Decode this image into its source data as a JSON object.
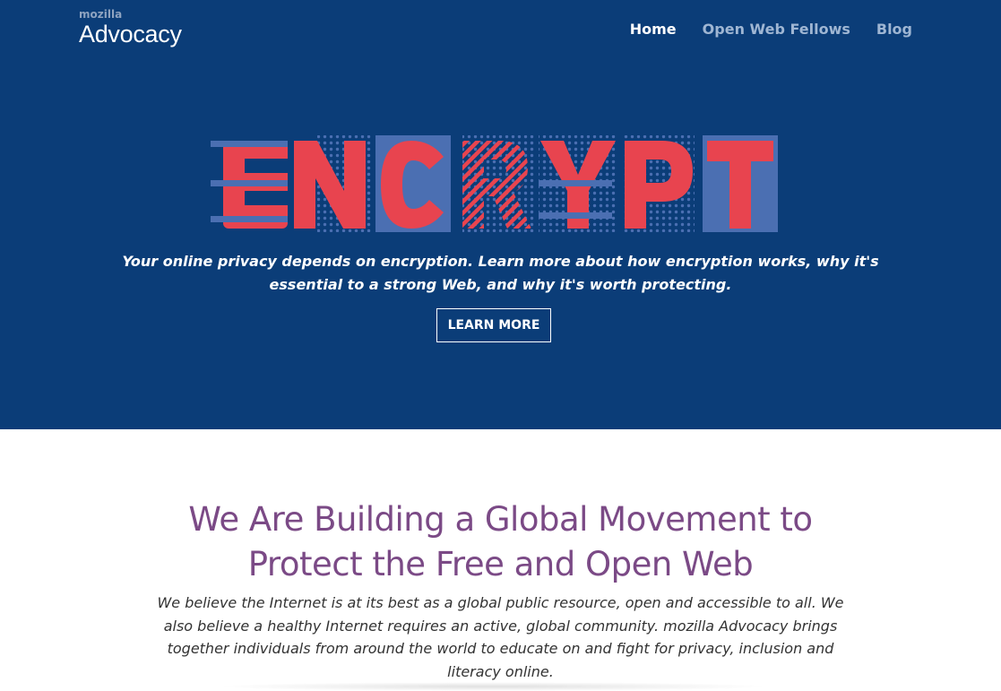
{
  "brand": {
    "small": "mozilla",
    "big": "Advocacy"
  },
  "nav": {
    "items": [
      {
        "label": "Home"
      },
      {
        "label": "Open Web Fellows"
      },
      {
        "label": "Blog"
      }
    ]
  },
  "hero": {
    "title": "ENCRYPT",
    "tagline_line1": "Your online privacy depends on encryption. Learn more about how encryption works, why it's",
    "tagline_line2": "essential to a strong Web, and why it's worth protecting.",
    "button_label": "LEARN MORE"
  },
  "section": {
    "headline_line1": "We Are Building a Global Movement to",
    "headline_line2": "Protect the Free and Open Web",
    "para_line1": "We believe the Internet is at its best as a global public resource, open and accessible to all. We",
    "para_line2": "also believe a healthy Internet requires an active, global community. mozilla Advocacy brings",
    "para_line3": "together individuals from around the world to educate on and fight for privacy, inclusion and",
    "para_line4": "literacy online."
  },
  "colors": {
    "hero_bg": "#0b3d78",
    "encrypt_red": "#e8444f",
    "encrypt_blue": "#4b6fb2",
    "headline_purple": "#7b4a86"
  }
}
